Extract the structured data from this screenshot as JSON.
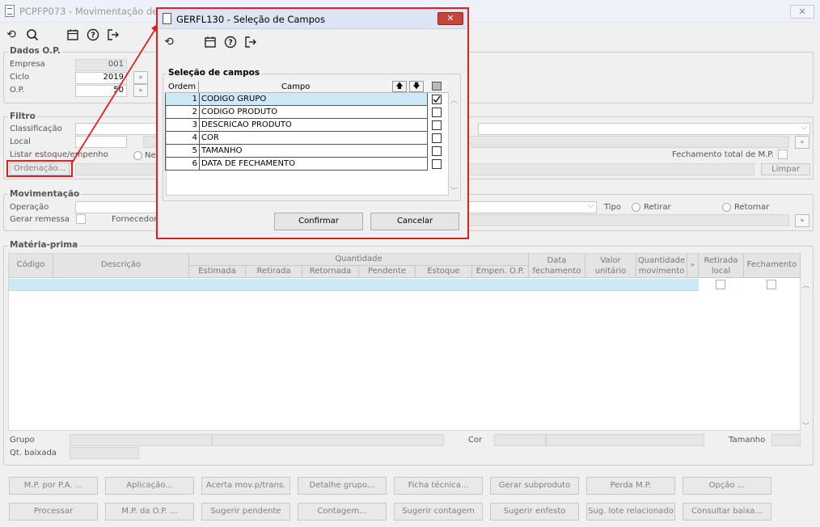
{
  "window": {
    "title": "PCPFP073 - Movimentação de M",
    "close_glyph": "✕"
  },
  "toolbar_icons": [
    "refresh-icon",
    "search-icon",
    "calendar-icon",
    "help-icon",
    "exit-icon"
  ],
  "dados_op": {
    "title": "Dados O.P.",
    "empresa_label": "Empresa",
    "empresa_value": "001",
    "ciclo_label": "Ciclo",
    "ciclo_value": "2019",
    "op_label": "O.P.",
    "op_value": "50"
  },
  "filtro": {
    "title": "Filtro",
    "classificacao_label": "Classificação",
    "local_label": "Local",
    "listar_label": "Listar estoque/empenho",
    "listar_option": "Ne",
    "ordenacao_button": "Ordenação...",
    "fechamento_label": "Fechamento total de M.P.",
    "limpar_button": "Limpar"
  },
  "movimentacao": {
    "title": "Movimentação",
    "operacao_label": "Operação",
    "gerar_remessa_label": "Gerar remessa",
    "fornecedor_label": "Fornecedor",
    "tipo_label": "Tipo",
    "retirar_label": "Retirar",
    "retornar_label": "Retornar"
  },
  "materia_prima": {
    "title": "Matéria-prima",
    "headers": {
      "codigo": "Código",
      "descricao": "Descrição",
      "quantidade": "Quantidade",
      "estimada": "Estimada",
      "retirada": "Retirada",
      "retornada": "Retornada",
      "pendente": "Pendente",
      "estoque": "Estoque",
      "empen_op": "Empen. O.P.",
      "data_fechamento": "Data fechamento",
      "valor_unitario": "Valor unitário",
      "quantidade_movimento": "Quantidade movimento",
      "retirada_local": "Retirada local",
      "fechamento": "Fechamento"
    },
    "grupo_label": "Grupo",
    "cor_label": "Cor",
    "tamanho_label": "Tamanho",
    "qt_baixada_label": "Qt. baixada"
  },
  "buttons_row1": [
    "M.P. por P.A. ...",
    "Aplicação...",
    "Acerta mov.p/trans.",
    "Detalhe grupo...",
    "Ficha técnica...",
    "Gerar subproduto",
    "Perda M.P.",
    "Opção ..."
  ],
  "buttons_row2": [
    "Processar",
    "M.P. da O.P. ...",
    "Sugerir pendente",
    "Contagem...",
    "Sugerir contagem",
    "Sugerir enfesto",
    "Sug. lote relacionado",
    "Consultar baixa..."
  ],
  "dialog": {
    "title": "GERFL130 - Seleção de Campos",
    "close_glyph": "✕",
    "group_title": "Seleção de campos",
    "col_ordem": "Ordem",
    "col_campo": "Campo",
    "rows": [
      {
        "ordem": "1",
        "campo": "CODIGO GRUPO",
        "checked": true
      },
      {
        "ordem": "2",
        "campo": "CODIGO PRODUTO",
        "checked": false
      },
      {
        "ordem": "3",
        "campo": "DESCRICAO PRODUTO",
        "checked": false
      },
      {
        "ordem": "4",
        "campo": "COR",
        "checked": false
      },
      {
        "ordem": "5",
        "campo": "TAMANHO",
        "checked": false
      },
      {
        "ordem": "6",
        "campo": "DATA DE FECHAMENTO",
        "checked": false
      }
    ],
    "confirmar_button": "Confirmar",
    "cancelar_button": "Cancelar"
  },
  "colors": {
    "accent_red": "#e0201c",
    "selection_blue": "#cde8f6",
    "title_bar": "#dbe5f4"
  }
}
